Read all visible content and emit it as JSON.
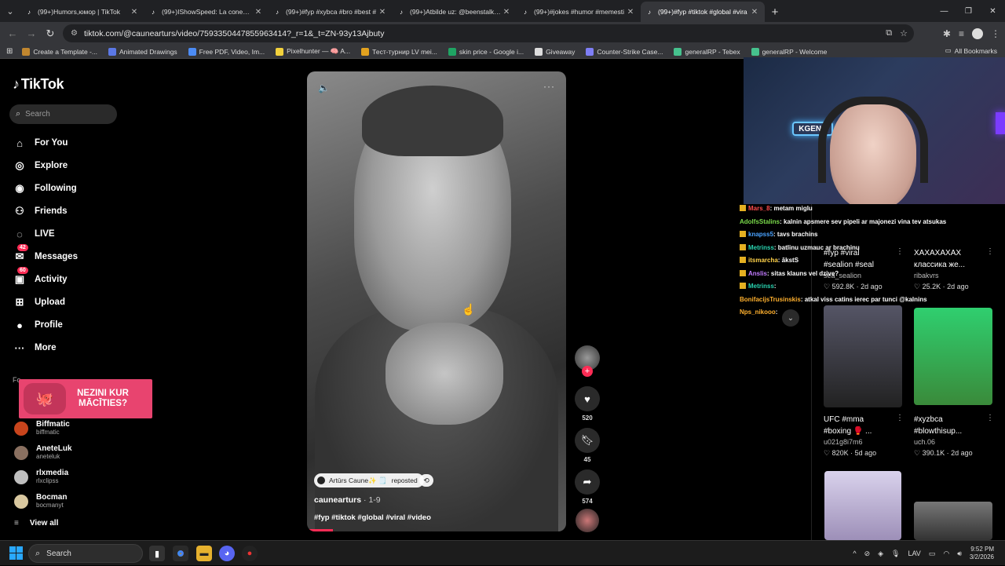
{
  "browser": {
    "tabs": [
      {
        "title": "(99+)Humors,юмор | TikTok",
        "active": false
      },
      {
        "title": "(99+)IShowSpeed: La conexión",
        "active": false
      },
      {
        "title": "(99+)#fyp #xybca #bro #best #",
        "active": false
      },
      {
        "title": "(99+)Atbilde uz: @beenstalk10",
        "active": false
      },
      {
        "title": "(99+)#jokes #humor #memesti",
        "active": false
      },
      {
        "title": "(99+)#fyp #tiktok #global #vira",
        "active": true
      }
    ],
    "url": "tiktok.com/@caunearturs/video/7593350447855963414?_r=1&_t=ZN-93y13Ajbuty",
    "bookmarks": [
      {
        "label": "Create a Template -...",
        "color": "#c1872f"
      },
      {
        "label": "Animated Drawings",
        "color": "#5b78e6"
      },
      {
        "label": "Free PDF, Video, Im...",
        "color": "#4c8cf5"
      },
      {
        "label": "Pixelhunter — 🧠 A...",
        "color": "#f2d13c"
      },
      {
        "label": "Тест-турнир LV mei...",
        "color": "#e2a21f"
      },
      {
        "label": "skin price - Google i...",
        "color": "#1fa463"
      },
      {
        "label": "Giveaway",
        "color": "#dddddd"
      },
      {
        "label": "Counter-Strike Case...",
        "color": "#7e7ef5"
      },
      {
        "label": "generalRP - Tebex",
        "color": "#46c28e"
      },
      {
        "label": "generalRP - Welcome",
        "color": "#46c28e"
      }
    ],
    "all_bookmarks": "All Bookmarks"
  },
  "sidebar": {
    "logo": "TikTok",
    "search_placeholder": "Search",
    "nav": [
      {
        "label": "For You",
        "icon": "home-icon",
        "badge": ""
      },
      {
        "label": "Explore",
        "icon": "compass-icon",
        "badge": ""
      },
      {
        "label": "Following",
        "icon": "following-icon",
        "badge": ""
      },
      {
        "label": "Friends",
        "icon": "friends-icon",
        "badge": ""
      },
      {
        "label": "LIVE",
        "icon": "live-icon",
        "badge": ""
      },
      {
        "label": "Messages",
        "icon": "messages-icon",
        "badge": "42"
      },
      {
        "label": "Activity",
        "icon": "activity-icon",
        "badge": "60"
      },
      {
        "label": "Upload",
        "icon": "upload-icon",
        "badge": ""
      },
      {
        "label": "Profile",
        "icon": "profile-icon",
        "badge": ""
      },
      {
        "label": "More",
        "icon": "more-icon",
        "badge": ""
      }
    ],
    "following_label": "Fo",
    "promo": "NEZINI KUR MĀCĪTIES?",
    "accounts": [
      {
        "name": "Biffmatic",
        "handle": "biffmatic"
      },
      {
        "name": "AneteLuk",
        "handle": "aneteluk"
      },
      {
        "name": "rlxmedia",
        "handle": "rlxclipss"
      },
      {
        "name": "Bocman",
        "handle": "bocmanyt"
      }
    ],
    "view_all": "View all"
  },
  "video": {
    "repost_author": "Artūrs Caune✨ 🗒️",
    "repost_label": "reposted",
    "author": "caunearturs",
    "date": "· 1-9",
    "tags": "#fyp #tiktok #global #viral #video",
    "progress": 0.1
  },
  "actions": {
    "likes": "520",
    "saves": "45",
    "shares": "574"
  },
  "webcam": {
    "neon_text": "KGENE"
  },
  "chat": [
    {
      "user": "Mars_8",
      "color": "#ff4d4d",
      "msg": ": metam miglu",
      "sub": true
    },
    {
      "user": "AdolfsStalins",
      "color": "#7bdc4b",
      "msg": ": kalnin apsmere sev pipeli ar majonezi vina tev atsukas",
      "sub": false
    },
    {
      "user": "knapss5",
      "color": "#4aa3ff",
      "msg": ": tavs brachins",
      "sub": true
    },
    {
      "user": "Metrinss",
      "color": "#29d3b0",
      "msg": ": batlinu uzmauc ar brachinu",
      "sub": true
    },
    {
      "user": "itsmarcha",
      "color": "#ffd24a",
      "msg": ": ākstS",
      "sub": true
    },
    {
      "user": "Anslis",
      "color": "#c27bff",
      "msg": ": sitas klauns vel dzive?",
      "sub": true
    },
    {
      "user": "Metrinss",
      "color": "#29d3b0",
      "msg": ":",
      "sub": true
    },
    {
      "user": "BonifacijsTrusinskis",
      "color": "#ffb02e",
      "msg": ": atkal viss catins ierec par tunci @kalnins",
      "sub": false
    },
    {
      "user": "Nps_nikooo",
      "color": "#ffb02e",
      "msg": ":",
      "sub": false
    }
  ],
  "grid": [
    {
      "title1": "#fyp #viral",
      "title2": "#sealion #seal",
      "user": "sea_sealion",
      "likes": "592.8K",
      "age": "2d ago"
    },
    {
      "title1": "ХАХАХАХАХ",
      "title2": "классика же...",
      "user": "ribakvrs",
      "likes": "25.2K",
      "age": "2d ago"
    },
    {
      "title1": "UFC #mma",
      "title2": "#boxing 🥊 ...",
      "user": "u021g8i7m6",
      "likes": "820K",
      "age": "5d ago"
    },
    {
      "title1": "#xyzbca",
      "title2": "#blowthisup...",
      "user": "uch.06",
      "likes": "390.1K",
      "age": "2d ago"
    }
  ],
  "taskbar": {
    "search": "Search",
    "lang": "LAV",
    "time": "9:52 PM",
    "date": "3/2/2026"
  }
}
